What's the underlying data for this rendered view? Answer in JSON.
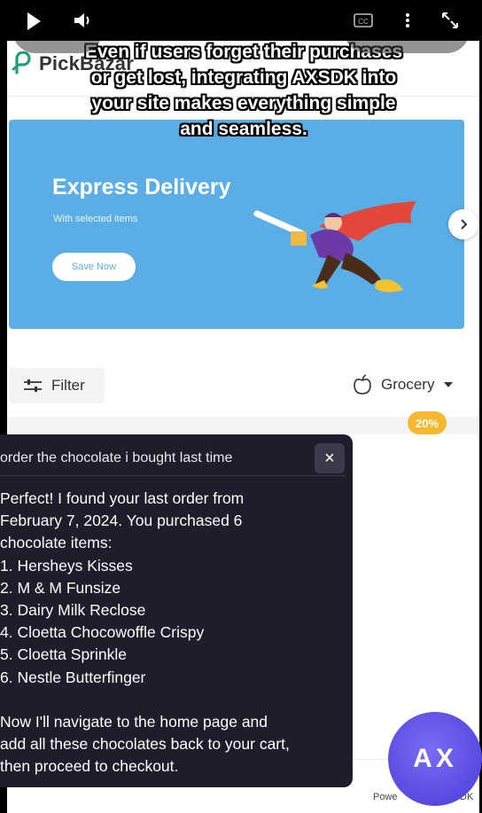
{
  "video": {
    "play_icon": "play-icon",
    "volume_icon": "volume-icon",
    "cc_icon": "closed-captions-icon",
    "more_icon": "more-vertical-icon",
    "fullscreen_icon": "fullscreen-icon",
    "cc_label": "CC"
  },
  "brand": {
    "name": "PickBazar",
    "logo_icon": "pickbazar-logo-icon"
  },
  "caption": {
    "lines": [
      "Even if users forget their purchases",
      "or get lost, integrating AXSDK into",
      "your site makes everything simple",
      "and seamless."
    ]
  },
  "banner": {
    "title": "Express Delivery",
    "subtitle": "With selected items",
    "button_label": "Save Now",
    "next_icon": "chevron-right-icon"
  },
  "toolbar": {
    "filter_label": "Filter",
    "category_label": "Grocery"
  },
  "product": {
    "discount": "20%"
  },
  "chat": {
    "query": "order the chocolate i bought last time",
    "close_label": "×",
    "response_lines": [
      "Perfect! I found your last order from",
      "February 7, 2024. You purchased 6",
      "chocolate items:",
      "1. Hersheys Kisses",
      "2. M & M Funsize",
      "3. Dairy Milk Reclose",
      "4. Cloetta Chocowoffle Crispy",
      "5. Cloetta Sprinkle",
      "6. Nestle Butterfinger"
    ],
    "closing_lines": [
      "Now I'll navigate to the home page and",
      "add all these chocolates back to your cart,",
      "then proceed to checkout."
    ]
  },
  "footer": {
    "powered_left": "Powe",
    "powered_right": "DK"
  },
  "assistant": {
    "label": "AX"
  },
  "colors": {
    "banner": "#5aaee5",
    "discount": "#f5b82e",
    "chat_bg": "#1d1d2b",
    "assistant": "#5a4ae3",
    "brand_green": "#1f9e74"
  }
}
